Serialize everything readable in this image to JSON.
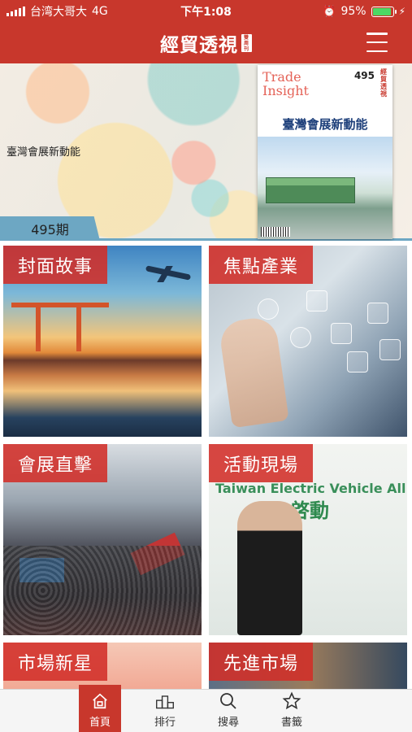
{
  "status_bar": {
    "carrier": "台湾大哥大",
    "network": "4G",
    "time": "下午1:08",
    "battery_percent": "95%",
    "battery_level": 0.95,
    "alarm_icon": "alarm-icon",
    "charging_icon": "bolt-icon"
  },
  "header": {
    "logo_text": "經貿透視",
    "logo_badge": "雙周刊",
    "menu_icon": "hamburger-menu-icon"
  },
  "hero": {
    "title": "臺灣會展新動能",
    "issue_label": "495期",
    "cover": {
      "brand_line1": "Trade",
      "brand_line2": "Insight",
      "issue_number": "495",
      "vertical_title": "經貿透視",
      "headline": "臺灣會展新動能"
    }
  },
  "tiles": [
    {
      "label": "封面故事"
    },
    {
      "label": "焦點產業"
    },
    {
      "label": "會展直擊"
    },
    {
      "label": "活動現場",
      "stage_text": "Taiwan Electric Vehicle All",
      "stage_zh": "啓動"
    },
    {
      "label": "市場新星"
    },
    {
      "label": "先進市場"
    }
  ],
  "tab_bar": {
    "items": [
      {
        "label": "首頁",
        "icon": "home-icon",
        "active": true
      },
      {
        "label": "排行",
        "icon": "podium-icon",
        "active": false
      },
      {
        "label": "搜尋",
        "icon": "search-icon",
        "active": false
      },
      {
        "label": "書籤",
        "icon": "star-icon",
        "active": false
      }
    ]
  },
  "colors": {
    "brand_red": "#c8372c",
    "tab_bar_bg": "#f5f5f5",
    "issue_tab_blue": "#6da7c3"
  }
}
